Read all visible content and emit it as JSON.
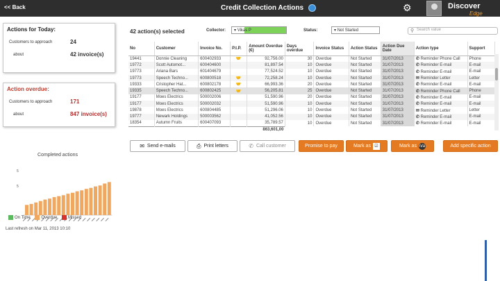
{
  "header": {
    "back_label": "<< Back",
    "title": "Credit Collection Actions",
    "brand": "Discover",
    "brand_sub": "Edge"
  },
  "today_panel": {
    "title": "Actions for Today:",
    "row1_label": "Customers to approach",
    "row1_value": "24",
    "row2_label": "about",
    "row2_value": "42 invoice(s)"
  },
  "overdue_panel": {
    "title": "Action overdue:",
    "row1_label": "Customers to approach",
    "row1_value": "171",
    "row2_label": "about",
    "row2_value": "847 invoice(s)"
  },
  "chart_data": {
    "type": "bar",
    "title": "Completed actions",
    "values": [
      2.1,
      2.3,
      2.6,
      2.9,
      3.2,
      3.4,
      3.7,
      3.9,
      4.1,
      4.4,
      4.6,
      4.9,
      5.1,
      5.4,
      5.6,
      5.9,
      6.1,
      6.5,
      6.8
    ],
    "ylim": [
      0,
      10
    ],
    "yticks": [
      "5",
      "5"
    ],
    "legend": [
      "On Time",
      "Overdue",
      "Missed"
    ],
    "colors": {
      "on_time": "#5cb85c",
      "overdue": "#f0a860",
      "missed": "#d9302c"
    }
  },
  "last_refresh": "Last refresh on Mar 11, 2013 10:10",
  "toolbar": {
    "selected_count": "42 action(s) selected",
    "collector_label": "Collector:",
    "collector_value": "Vikas P",
    "status_label": "Status:",
    "status_value": "Not Started",
    "search_placeholder": "Search value"
  },
  "table": {
    "columns": [
      "No",
      "Customer",
      "Invoice No.",
      "P.t.P.",
      "Amount Overdue (€)",
      "Days overdue",
      "Invoice Status",
      "Action Status",
      "Action Due Date",
      "Action type",
      "Support"
    ],
    "rows": [
      {
        "no": "19441",
        "customer": "Donnie Cleaning",
        "invoice": "600402933",
        "ptp": "",
        "amount": "92,756.00",
        "days": "30",
        "inv_status": "Overdue",
        "act_status": "Not Started",
        "due": "31/07/2013",
        "icon": "✆",
        "type": "Reminder Phone Call",
        "support": "Phone"
      },
      {
        "no": "19772",
        "customer": "Scott Automot...",
        "invoice": "600404600",
        "ptp": "",
        "amount": "81,897.54",
        "days": "10",
        "inv_status": "Overdue",
        "act_status": "Not Started",
        "due": "31/07/2013",
        "icon": "✆",
        "type": "Reminder E-mail",
        "support": "E-mail"
      },
      {
        "no": "19773",
        "customer": "Ariana Bars",
        "invoice": "601404679",
        "ptp": "",
        "amount": "77,524.52",
        "days": "10",
        "inv_status": "Overdue",
        "act_status": "Not Started",
        "due": "31/07/2013",
        "icon": "✆",
        "type": "Reminder E-mail",
        "support": "E-mail"
      },
      {
        "no": "19773",
        "customer": "Speech Techno...",
        "invoice": "600800518",
        "ptp": "",
        "amount": "72,258.24",
        "days": "10",
        "inv_status": "Overdue",
        "act_status": "Not Started",
        "due": "31/07/2013",
        "icon": "✉",
        "type": "Reminder Letter",
        "support": "Letter"
      },
      {
        "no": "19333",
        "customer": "Cristopher Hat...",
        "invoice": "600802178",
        "ptp": "",
        "amount": "66,993.36",
        "days": "20",
        "inv_status": "Overdue",
        "act_status": "Not Started",
        "due": "31/07/2013",
        "icon": "✆",
        "type": "Reminder E-mail",
        "support": "E-mail"
      },
      {
        "no": "19335",
        "customer": "Speech Techno...",
        "invoice": "600802425",
        "ptp": "",
        "amount": "56,205.81",
        "days": "25",
        "inv_status": "Overdue",
        "act_status": "Not Started",
        "due": "31/07/2013",
        "icon": "✆",
        "type": "Reminder Phone Call",
        "support": "Phone"
      },
      {
        "no": "19177",
        "customer": "Moes Electrics",
        "invoice": "500002006",
        "ptp": "",
        "amount": "51,590.96",
        "days": "20",
        "inv_status": "Overdue",
        "act_status": "Not Started",
        "due": "31/07/2013",
        "icon": "✆",
        "type": "Reminder E-mail",
        "support": "E-mail"
      },
      {
        "no": "19177",
        "customer": "Moes Electrics",
        "invoice": "500002032",
        "ptp": "",
        "amount": "51,590.96",
        "days": "10",
        "inv_status": "Overdue",
        "act_status": "Not Started",
        "due": "31/07/2013",
        "icon": "✆",
        "type": "Reminder E-mail",
        "support": "E-mail"
      },
      {
        "no": "19878",
        "customer": "Moes Electrics",
        "invoice": "600804485",
        "ptp": "",
        "amount": "51,296.06",
        "days": "10",
        "inv_status": "Overdue",
        "act_status": "Not Started",
        "due": "31/07/2013",
        "icon": "✉",
        "type": "Reminder Letter",
        "support": "Letter"
      },
      {
        "no": "19777",
        "customer": "Newark Holdings",
        "invoice": "500003562",
        "ptp": "",
        "amount": "41,052.56",
        "days": "10",
        "inv_status": "Overdue",
        "act_status": "Not Started",
        "due": "31/07/2013",
        "icon": "✆",
        "type": "Reminder E-mail",
        "support": "E-mail"
      },
      {
        "no": "18354",
        "customer": "Autumn Fruits",
        "invoice": "600407093",
        "ptp": "",
        "amount": "35,789.57",
        "days": "10",
        "inv_status": "Overdue",
        "act_status": "Not Started",
        "due": "31/07/2013",
        "icon": "✆",
        "type": "Reminder E-mail",
        "support": "E-mail"
      }
    ],
    "total": "863,601,00"
  },
  "buttons": {
    "send_emails": "Send e-mails",
    "print_letters": "Print letters",
    "call_customer": "Call customer",
    "promise_to_pay": "Promise to pay",
    "mark_as_1": "Mark as",
    "mark_as_2": "Mark as",
    "add_action": "Add specific action"
  }
}
